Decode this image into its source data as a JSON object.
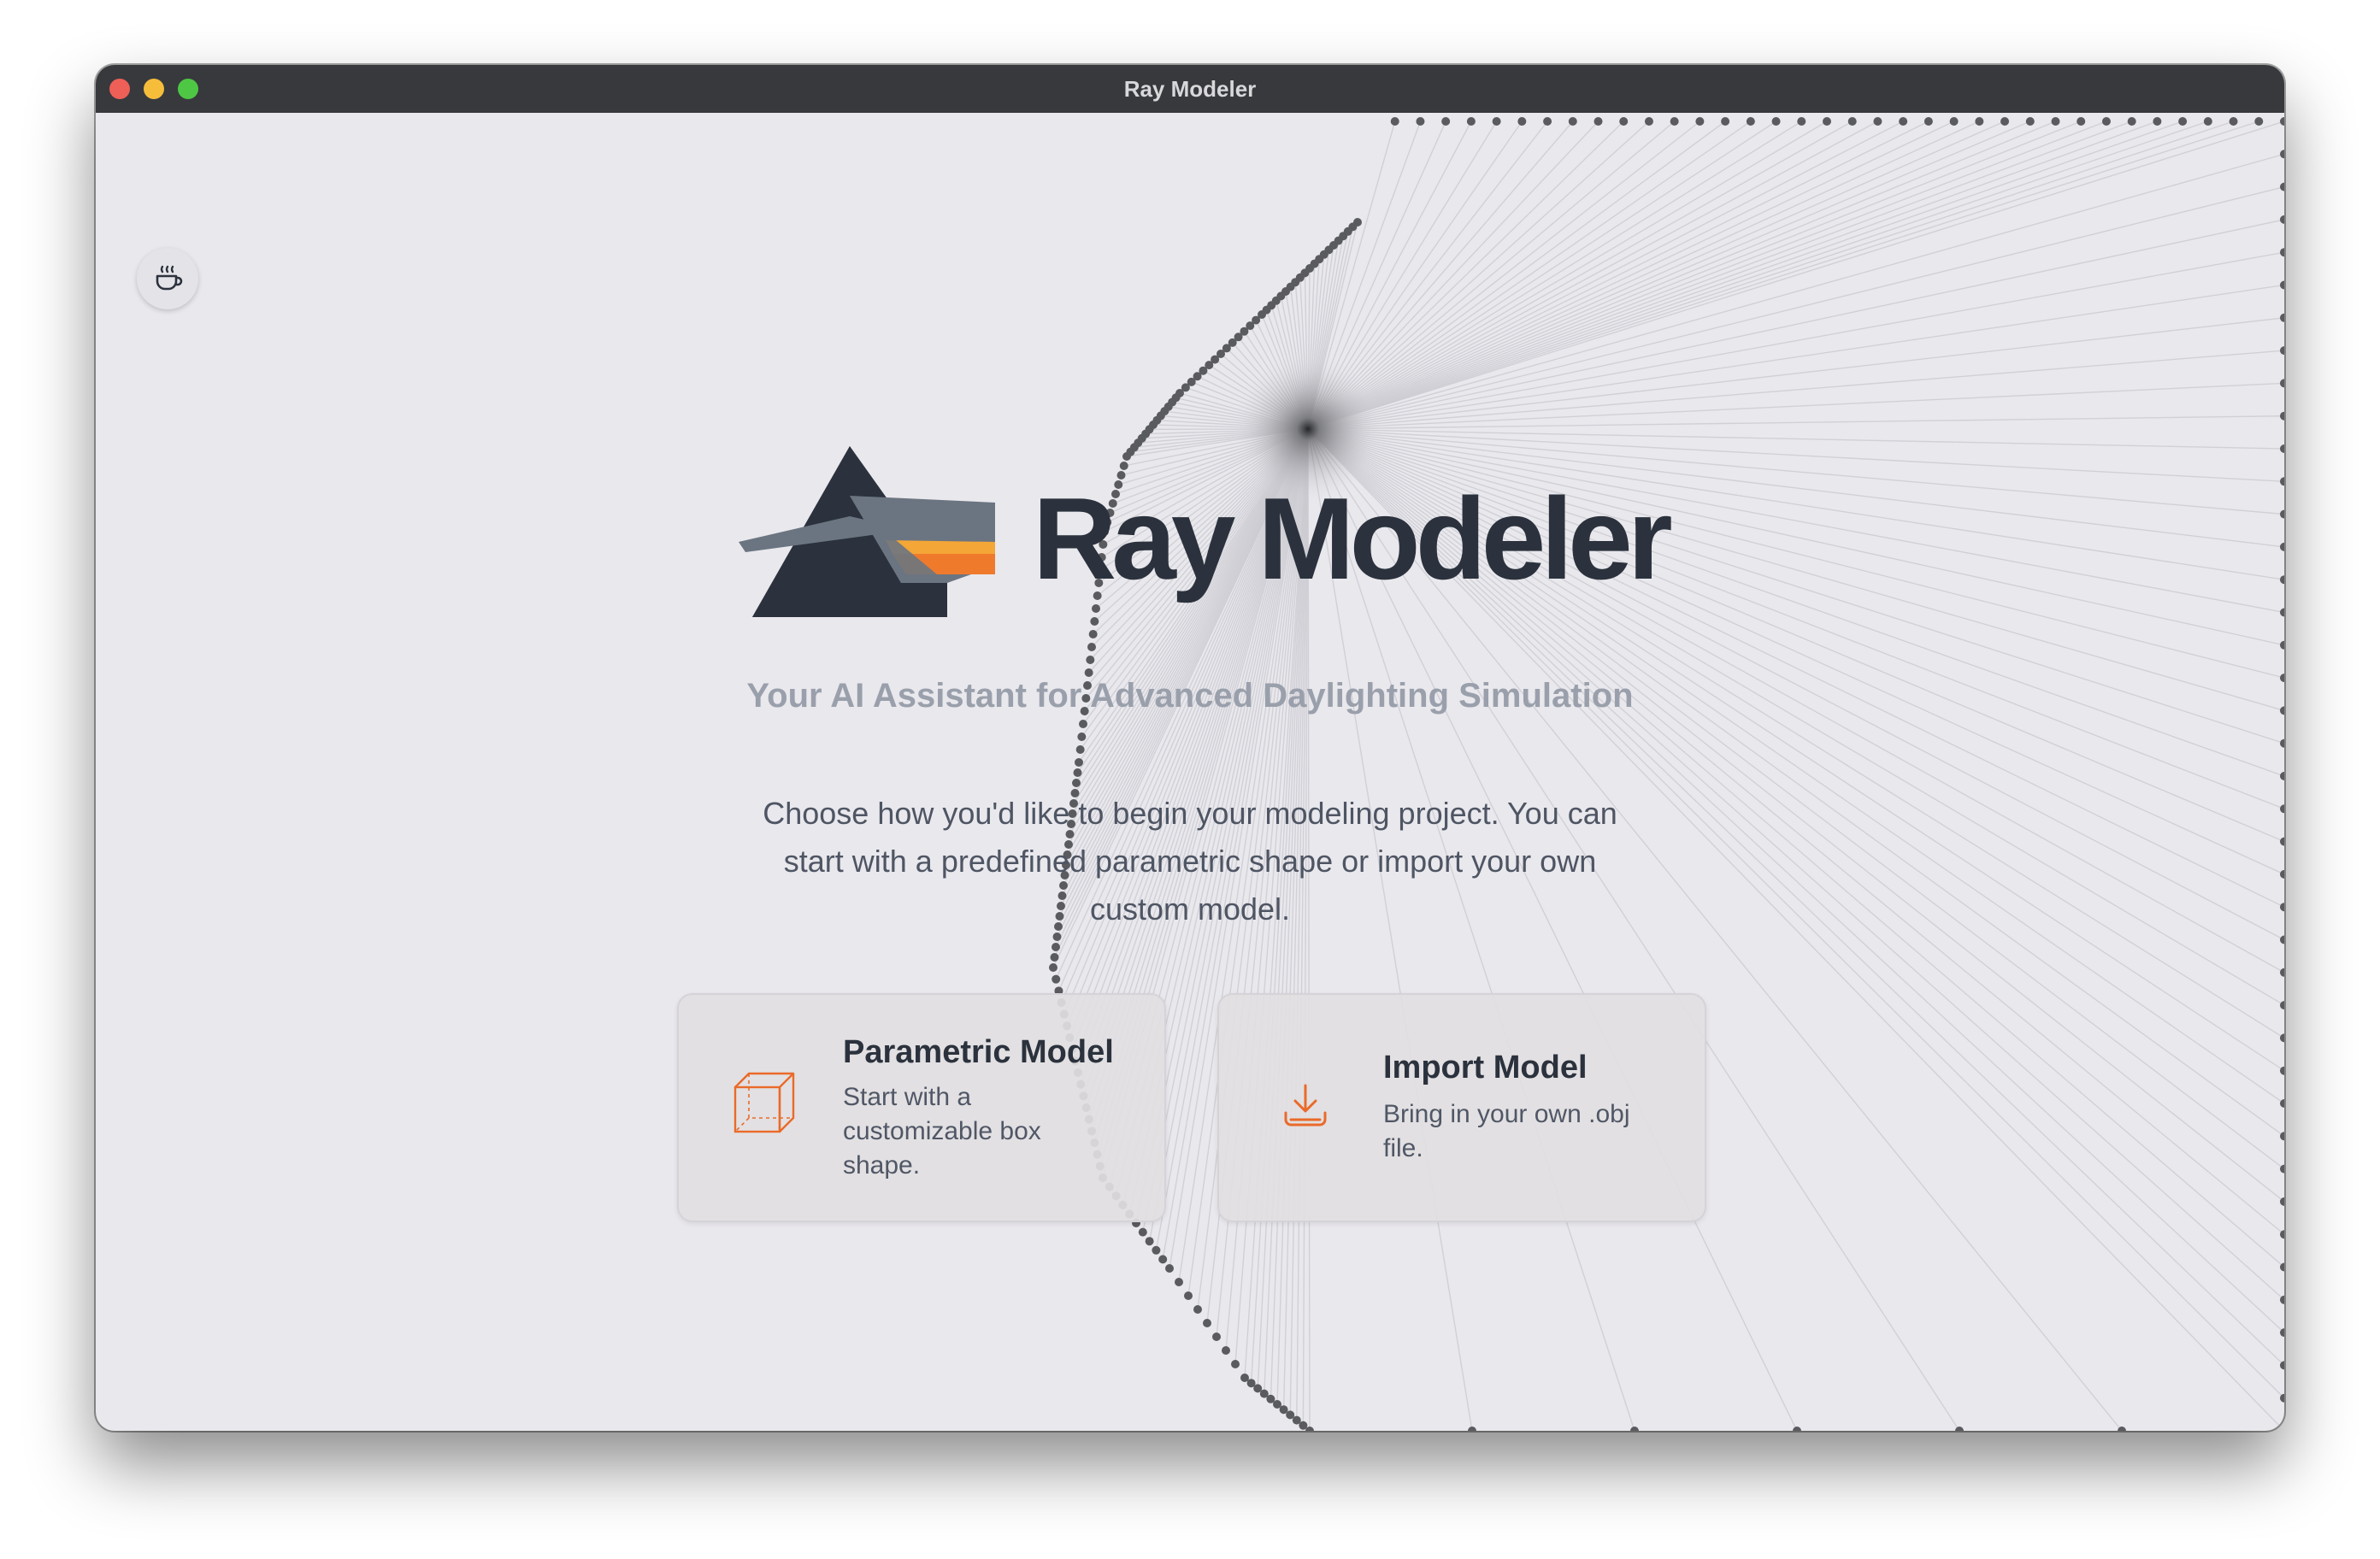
{
  "window": {
    "title": "Ray Modeler"
  },
  "toolbar": {
    "coffee_icon": "coffee-cup-icon"
  },
  "hero": {
    "app_name": "Ray Modeler",
    "tagline": "Your AI Assistant for Advanced Daylighting Simulation",
    "intro": "Choose how you'd like to begin your modeling project. You can start with a predefined parametric shape or import your own custom model."
  },
  "cards": {
    "parametric": {
      "title": "Parametric Model",
      "description": "Start with a customizable box shape.",
      "icon": "cube-icon"
    },
    "import": {
      "title": "Import Model",
      "description": "Bring in your own .obj file.",
      "icon": "download-icon"
    }
  },
  "colors": {
    "window_bg": "#e9e8ed",
    "titlebar": "#37393c",
    "text_dark": "#2b323d",
    "text_muted": "#9aa0ab",
    "accent_orange": "#ea6a2a",
    "prism_dark": "#2b323d",
    "beam_grey": "#6b7581",
    "beam_yellow": "#f4a637",
    "beam_orange": "#ef7a2c"
  }
}
